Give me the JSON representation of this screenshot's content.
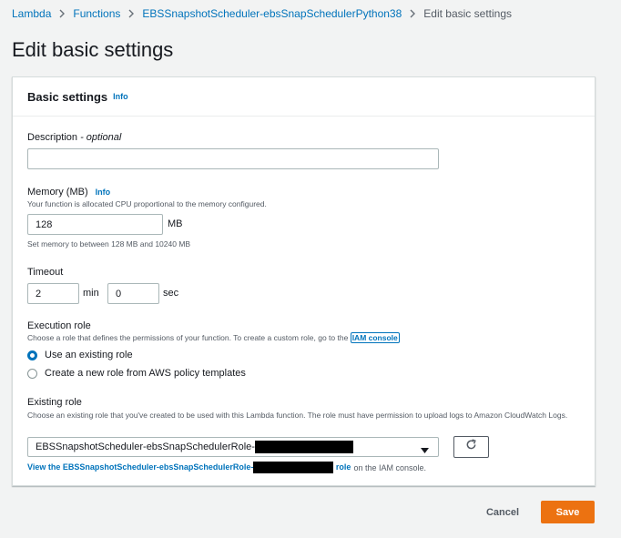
{
  "breadcrumb": {
    "items": [
      "Lambda",
      "Functions",
      "EBSSnapshotScheduler-ebsSnapSchedulerPython38"
    ],
    "current": "Edit basic settings"
  },
  "page": {
    "title": "Edit basic settings"
  },
  "card": {
    "title": "Basic settings",
    "info": "Info"
  },
  "description": {
    "label": "Description",
    "optional": " - optional",
    "value": "",
    "placeholder": ""
  },
  "memory": {
    "label": "Memory (MB)",
    "info": "Info",
    "hint": "Your function is allocated CPU proportional to the memory configured.",
    "value": "128",
    "unit": "MB",
    "constraint": "Set memory to between 128 MB and 10240 MB"
  },
  "timeout": {
    "label": "Timeout",
    "min_value": "2",
    "min_unit": "min",
    "sec_value": "0",
    "sec_unit": "sec"
  },
  "execution_role": {
    "label": "Execution role",
    "hint_prefix": "Choose a role that defines the permissions of your function. To create a custom role, go to the ",
    "iam_console": "IAM console",
    "options": [
      {
        "label": "Use an existing role",
        "selected": true
      },
      {
        "label": "Create a new role from AWS policy templates",
        "selected": false
      }
    ]
  },
  "existing_role": {
    "label": "Existing role",
    "hint": "Choose an existing role that you've created to be used with this Lambda function. The role must have permission to upload logs to Amazon CloudWatch Logs.",
    "selected_prefix": "EBSSnapshotScheduler-ebsSnapSchedulerRole-",
    "view_link_prefix": "View the EBSSnapshotScheduler-ebsSnapSchedulerRole-",
    "view_link_suffix": "role",
    "view_suffix_text": "on the IAM console."
  },
  "actions": {
    "cancel": "Cancel",
    "save": "Save"
  },
  "colors": {
    "link": "#0073bb",
    "primary": "#ec7211",
    "background": "#f2f3f3",
    "redaction": "#000000"
  }
}
